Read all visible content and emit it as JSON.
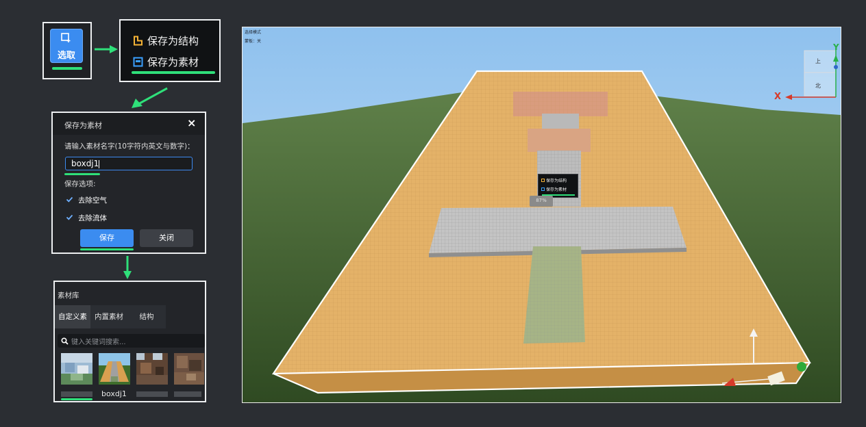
{
  "select_tool": {
    "label": "选取"
  },
  "save_menu": {
    "save_as_structure": "保存为结构",
    "save_as_asset": "保存为素材"
  },
  "save_dialog": {
    "title": "保存为素材",
    "close_glyph": "×",
    "name_prompt": "请输入素材名字(10字符内英文与数字)：",
    "name_value": "boxdj1",
    "options_label": "保存选项:",
    "option_remove_air": "去除空气",
    "option_remove_fluid": "去除流体",
    "save_button": "保存",
    "close_button": "关闭"
  },
  "asset_library": {
    "title": "素材库",
    "tabs": [
      "自定义素材",
      "内置素材",
      "结构"
    ],
    "search_placeholder": "键入关键词搜索...",
    "items": [
      {
        "name": ""
      },
      {
        "name": "boxdj1"
      },
      {
        "name": ""
      },
      {
        "name": ""
      }
    ]
  },
  "viewport": {
    "mode_label": "选择模式",
    "template_label": "蒙板：关",
    "popup_structure": "保存为结构",
    "popup_asset": "保存为素材",
    "progress_text": "87%",
    "progress": 0.87,
    "compass": {
      "top": "上",
      "north": "北",
      "axis_y": "Y",
      "axis_x": "X"
    }
  },
  "colors": {
    "accent_blue": "#3b8cf0",
    "highlight_green": "#2fe07a",
    "structure_icon": "#f5b335",
    "asset_icon": "#3aa0ff"
  }
}
